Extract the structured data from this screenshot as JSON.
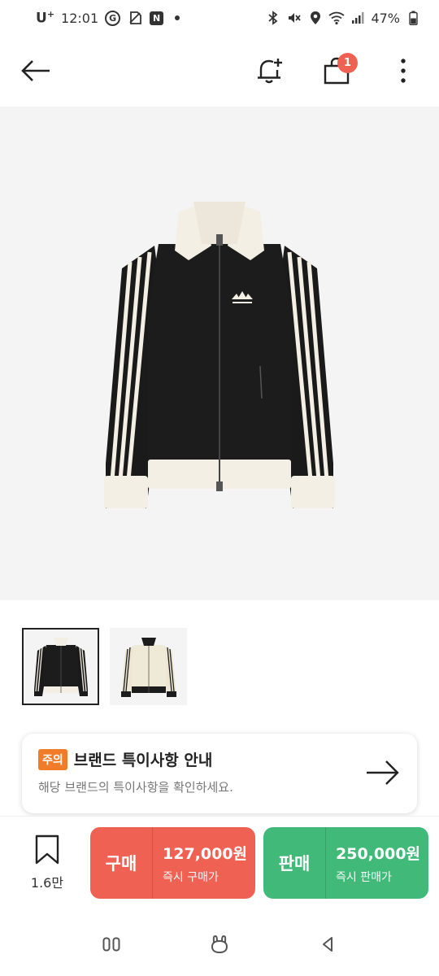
{
  "status_bar": {
    "carrier": "U",
    "carrier_sup": "+",
    "time": "12:01",
    "g_icon": "G",
    "n_icon": "N",
    "battery": "47%"
  },
  "icons": {
    "back": "arrow-left-icon",
    "notify": "bell-plus-icon",
    "cart": "shopping-bag-icon",
    "more": "more-vertical-icon"
  },
  "header": {
    "cart_count": "1"
  },
  "notice": {
    "tag": "주의",
    "title": "브랜드 특이사항 안내",
    "description": "해당 브랜드의 특이사항을 확인하세요."
  },
  "bottom_bar": {
    "wish_count": "1.6만",
    "buy": {
      "label": "구매",
      "price": "127,000원",
      "sub": "즉시 구매가"
    },
    "sell": {
      "label": "판매",
      "price": "250,000원",
      "sub": "즉시 판매가"
    }
  },
  "colors": {
    "buy": "#ef6253",
    "sell": "#41b979",
    "notice_tag": "#f07c29",
    "badge": "#ef6253"
  }
}
